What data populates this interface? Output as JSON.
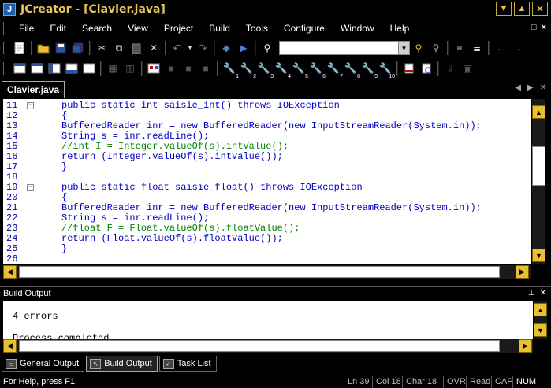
{
  "window": {
    "app_icon_letter": "J",
    "title": "JCreator - [Clavier.java]",
    "min": "▼",
    "max": "▲",
    "close": "✕"
  },
  "menu": {
    "items": [
      "File",
      "Edit",
      "Search",
      "View",
      "Project",
      "Build",
      "Tools",
      "Configure",
      "Window",
      "Help"
    ],
    "mdi_buttons": [
      "_",
      "□",
      "×"
    ]
  },
  "editor": {
    "tab": "Clavier.java",
    "lines": [
      {
        "n": "11",
        "text": "public static int saisie_int() throws IOException",
        "type": "code",
        "fold": "minus"
      },
      {
        "n": "12",
        "text": "{",
        "type": "code"
      },
      {
        "n": "13",
        "text": "BufferedReader inr = new BufferedReader(new InputStreamReader(System.in));",
        "type": "code"
      },
      {
        "n": "14",
        "text": "String s = inr.readLine();",
        "type": "code"
      },
      {
        "n": "15",
        "text": "//int I = Integer.valueOf(s).intValue();",
        "type": "comment"
      },
      {
        "n": "16",
        "text": "return (Integer.valueOf(s).intValue());",
        "type": "code"
      },
      {
        "n": "17",
        "text": "}",
        "type": "code"
      },
      {
        "n": "18",
        "text": "",
        "type": "code"
      },
      {
        "n": "19",
        "text": "public static float saisie_float() throws IOException",
        "type": "code",
        "fold": "minus"
      },
      {
        "n": "20",
        "text": "{",
        "type": "code"
      },
      {
        "n": "21",
        "text": "BufferedReader inr = new BufferedReader(new InputStreamReader(System.in));",
        "type": "code"
      },
      {
        "n": "22",
        "text": "String s = inr.readLine();",
        "type": "code"
      },
      {
        "n": "23",
        "text": "//float F = Float.valueOf(s).floatValue();",
        "type": "comment"
      },
      {
        "n": "24",
        "text": "return (Float.valueOf(s).floatValue());",
        "type": "code"
      },
      {
        "n": "25",
        "text": "}",
        "type": "code"
      },
      {
        "n": "26",
        "text": "",
        "type": "code"
      }
    ]
  },
  "output_panel": {
    "title": "Build Output",
    "lines": [
      "4 errors",
      "",
      "Process completed."
    ],
    "tabs": [
      {
        "label": "General Output",
        "active": false
      },
      {
        "label": "Build Output",
        "active": true
      },
      {
        "label": "Task List",
        "active": false
      }
    ]
  },
  "status": {
    "help": "For Help, press F1",
    "ln": "Ln 39",
    "col": "Col 18",
    "char": "Char 18",
    "ovr": "OVR",
    "read": "Read",
    "cap": "CAP",
    "num": "NUM"
  },
  "colors": {
    "title_text": "#e8c65a",
    "scroll_button": "#e8c030",
    "code_blue": "#0000c0",
    "comment_green": "#008000"
  }
}
